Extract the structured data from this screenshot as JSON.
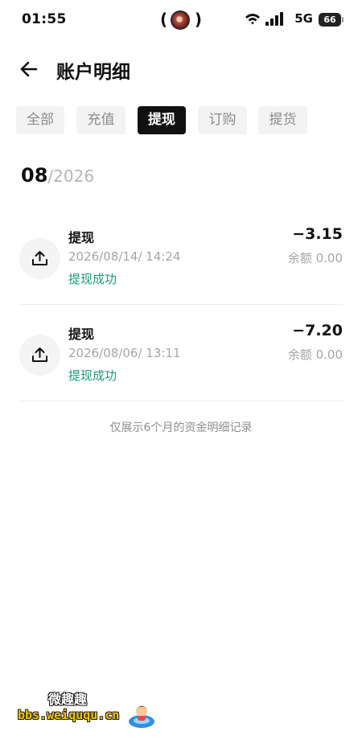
{
  "status_bar": {
    "time": "01:55",
    "network": "5G",
    "battery": "66"
  },
  "header": {
    "title": "账户明细"
  },
  "tabs": [
    {
      "label": "全部",
      "active": false
    },
    {
      "label": "充值",
      "active": false
    },
    {
      "label": "提现",
      "active": true
    },
    {
      "label": "订购",
      "active": false
    },
    {
      "label": "提货",
      "active": false
    }
  ],
  "month": {
    "month": "08",
    "year": "/2026"
  },
  "records": [
    {
      "title": "提现",
      "time": "2026/08/14/ 14:24",
      "status": "提现成功",
      "amount": "−3.15",
      "balance": "余额 0.00"
    },
    {
      "title": "提现",
      "time": "2026/08/06/ 13:11",
      "status": "提现成功",
      "amount": "−7.20",
      "balance": "余额 0.00"
    }
  ],
  "footnote": "仅展示6个月的资金明细记录",
  "watermark": {
    "line1": "微趣趣",
    "line2": "bbs.weiququ.cn"
  },
  "colors": {
    "success": "#1a9a7a",
    "active_tab": "#111111"
  }
}
